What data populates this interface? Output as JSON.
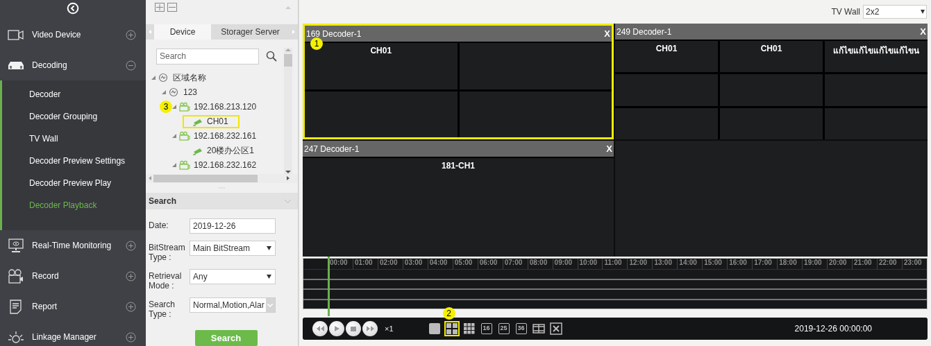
{
  "sidebar": {
    "items": [
      {
        "kind": "camera",
        "label": "Video Device",
        "expanded": false
      },
      {
        "kind": "decoder",
        "label": "Decoding",
        "expanded": true,
        "children": [
          {
            "label": "Decoder",
            "selected": false
          },
          {
            "label": "Decoder Grouping",
            "selected": false
          },
          {
            "label": "TV Wall",
            "selected": false
          },
          {
            "label": "Decoder Preview Settings",
            "selected": false
          },
          {
            "label": "Decoder Preview Play",
            "selected": false
          },
          {
            "label": "Decoder Playback",
            "selected": true
          }
        ]
      },
      {
        "kind": "monitor",
        "label": "Real-Time Monitoring",
        "expanded": false
      },
      {
        "kind": "record",
        "label": "Record",
        "expanded": false
      },
      {
        "kind": "report",
        "label": "Report",
        "expanded": false
      },
      {
        "kind": "linkage",
        "label": "Linkage Manager",
        "expanded": false
      }
    ]
  },
  "device_panel": {
    "tabs": [
      {
        "label": "Device",
        "selected": true
      },
      {
        "label": "Storager Server",
        "selected": false
      }
    ],
    "search": {
      "placeholder": "Search"
    },
    "tree": [
      {
        "kind": "area",
        "label": "区域名称",
        "expanded": true,
        "children": [
          {
            "kind": "area",
            "label": "123",
            "expanded": true,
            "children": [
              {
                "kind": "device",
                "label": "192.168.213.120",
                "expanded": true,
                "badge": "3",
                "children": [
                  {
                    "kind": "channel",
                    "label": "CH01",
                    "highlighted": true
                  }
                ]
              },
              {
                "kind": "device",
                "label": "192.168.232.161",
                "expanded": true,
                "children": [
                  {
                    "kind": "channel",
                    "label": "20楼办公区1",
                    "highlighted": false
                  }
                ]
              },
              {
                "kind": "device",
                "label": "192.168.232.162",
                "expanded": true
              }
            ]
          }
        ]
      }
    ],
    "search_section": {
      "title": "Search",
      "fields": [
        {
          "kind": "text",
          "label": "Date:",
          "value": "2019-12-26"
        },
        {
          "kind": "select",
          "label": "BitStream Type :",
          "value": "Main BitStream"
        },
        {
          "kind": "select",
          "label": "Retrieval Mode :",
          "value": "Any"
        },
        {
          "kind": "multiselect",
          "label": "Search Type :",
          "value": "Normal,Motion,Alar"
        }
      ],
      "button": "Search"
    }
  },
  "top_bar": {
    "label": "TV Wall",
    "value": "2x2"
  },
  "wall": {
    "screens": [
      {
        "kind": "decoder",
        "title": "169 Decoder-1",
        "close": "X",
        "selected": true,
        "badge": "1",
        "cells": [
          {
            "kind": "channel",
            "label": "CH01"
          },
          {
            "kind": "empty"
          },
          {
            "kind": "empty"
          },
          {
            "kind": "empty"
          }
        ]
      },
      {
        "kind": "decoder",
        "title": "249 Decoder-1",
        "close": "X",
        "selected": false,
        "cells": [
          {
            "kind": "channel",
            "label": "CH01"
          },
          {
            "kind": "channel",
            "label": "CH01"
          },
          {
            "kind": "channel",
            "label": "แก้ไขแก้ไขแก้ไขแก้ไขน"
          },
          {
            "kind": "empty"
          },
          {
            "kind": "empty"
          },
          {
            "kind": "empty"
          },
          {
            "kind": "empty"
          },
          {
            "kind": "empty"
          },
          {
            "kind": "empty"
          }
        ]
      },
      {
        "kind": "decoder",
        "title": "247 Decoder-1",
        "close": "X",
        "selected": false,
        "cells": [
          {
            "kind": "channel",
            "label": "181-CH1"
          }
        ]
      },
      {
        "kind": "blank"
      }
    ]
  },
  "timeline": {
    "level": 0,
    "hours": [
      "00:00",
      "01:00",
      "02:00",
      "03:00",
      "04:00",
      "05:00",
      "06:00",
      "07:00",
      "08:00",
      "09:00",
      "10:00",
      "11:00",
      "12:00",
      "13:00",
      "14:00",
      "15:00",
      "16:00",
      "17:00",
      "18:00",
      "19:00",
      "20:00",
      "21:00",
      "22:00",
      "23:00"
    ]
  },
  "playback": {
    "controls": [
      {
        "kind": "rewind"
      },
      {
        "kind": "play"
      },
      {
        "kind": "stop"
      },
      {
        "kind": "forward"
      }
    ],
    "speed": "×1",
    "layouts": [
      {
        "kind": "single",
        "selected": false
      },
      {
        "kind": "quad",
        "selected": true,
        "badge": "2"
      },
      {
        "kind": "nine",
        "selected": false
      },
      {
        "kind": "numbered",
        "label": "16",
        "selected": false
      },
      {
        "kind": "numbered",
        "label": "25",
        "selected": false
      },
      {
        "kind": "numbered",
        "label": "36",
        "selected": false
      },
      {
        "kind": "film",
        "selected": false
      },
      {
        "kind": "close",
        "selected": false
      }
    ],
    "datetime": "2019-12-26 00:00:00"
  }
}
